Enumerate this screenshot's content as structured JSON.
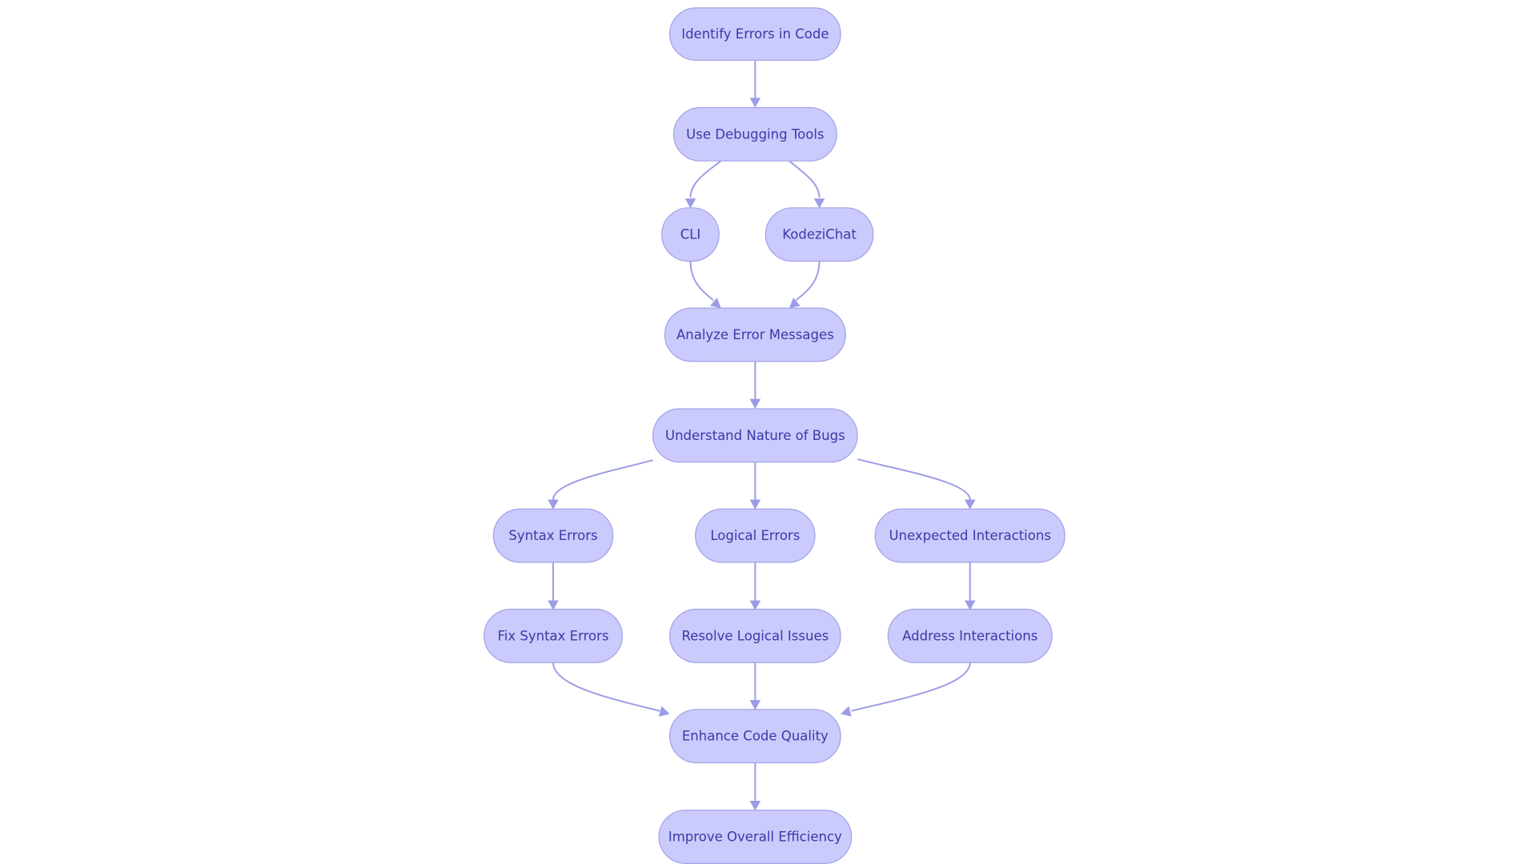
{
  "diagram": {
    "type": "flowchart",
    "direction": "top-down",
    "colors": {
      "node_fill": "#CACAFC",
      "node_stroke": "#A3A3E8",
      "text": "#3A3AA8",
      "edge": "#9C9CE6",
      "background": "#FFFFFF"
    },
    "nodes": [
      {
        "id": "identify",
        "label": "Identify Errors in Code"
      },
      {
        "id": "debug",
        "label": "Use Debugging Tools"
      },
      {
        "id": "cli",
        "label": "CLI"
      },
      {
        "id": "kodezi",
        "label": "KodeziChat"
      },
      {
        "id": "analyze",
        "label": "Analyze Error Messages"
      },
      {
        "id": "understand",
        "label": "Understand Nature of Bugs"
      },
      {
        "id": "syntax",
        "label": "Syntax Errors"
      },
      {
        "id": "logical",
        "label": "Logical Errors"
      },
      {
        "id": "unexpected",
        "label": "Unexpected Interactions"
      },
      {
        "id": "fixsyntax",
        "label": "Fix Syntax Errors"
      },
      {
        "id": "resolve",
        "label": "Resolve Logical Issues"
      },
      {
        "id": "address",
        "label": "Address Interactions"
      },
      {
        "id": "enhance",
        "label": "Enhance Code Quality"
      },
      {
        "id": "improve",
        "label": "Improve Overall Efficiency"
      }
    ],
    "edges": [
      {
        "from": "identify",
        "to": "debug"
      },
      {
        "from": "debug",
        "to": "cli"
      },
      {
        "from": "debug",
        "to": "kodezi"
      },
      {
        "from": "cli",
        "to": "analyze"
      },
      {
        "from": "kodezi",
        "to": "analyze"
      },
      {
        "from": "analyze",
        "to": "understand"
      },
      {
        "from": "understand",
        "to": "syntax"
      },
      {
        "from": "understand",
        "to": "logical"
      },
      {
        "from": "understand",
        "to": "unexpected"
      },
      {
        "from": "syntax",
        "to": "fixsyntax"
      },
      {
        "from": "logical",
        "to": "resolve"
      },
      {
        "from": "unexpected",
        "to": "address"
      },
      {
        "from": "fixsyntax",
        "to": "enhance"
      },
      {
        "from": "resolve",
        "to": "enhance"
      },
      {
        "from": "address",
        "to": "enhance"
      },
      {
        "from": "enhance",
        "to": "improve"
      }
    ]
  }
}
